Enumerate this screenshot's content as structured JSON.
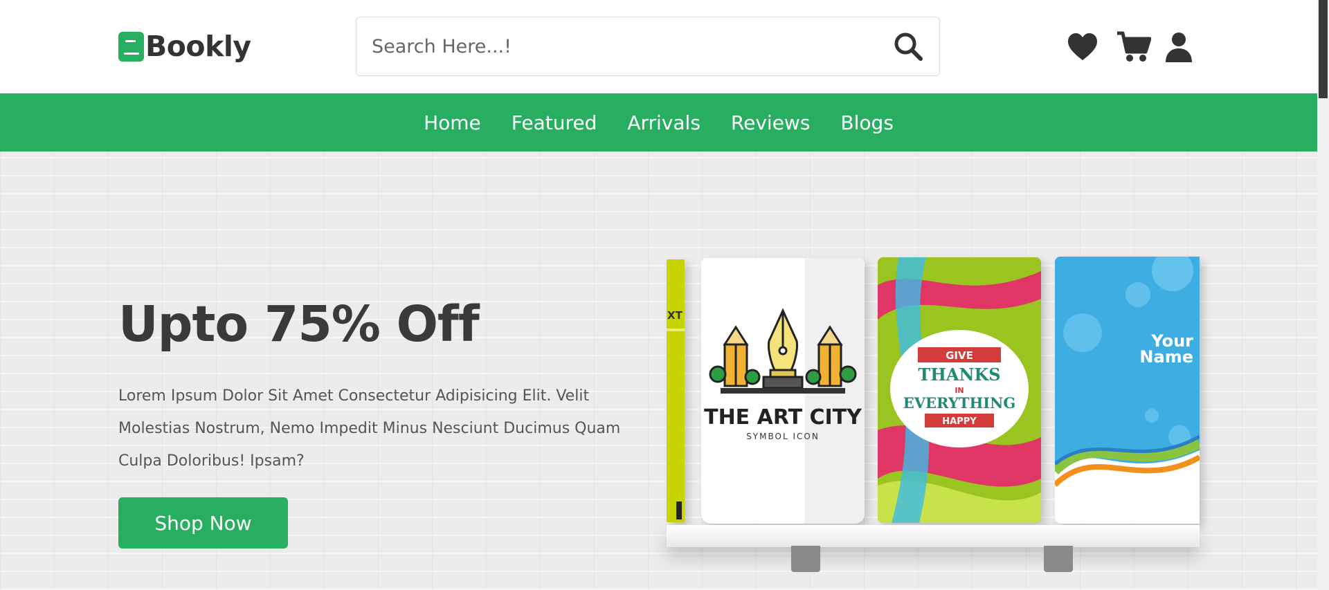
{
  "logo": {
    "text": "Bookly",
    "icon": "book-icon"
  },
  "search": {
    "placeholder": "Search Here...!",
    "value": "",
    "icon": "search-icon"
  },
  "header_icons": [
    {
      "name": "heart-icon",
      "label": "Wishlist"
    },
    {
      "name": "cart-icon",
      "label": "Cart"
    },
    {
      "name": "user-icon",
      "label": "Account"
    }
  ],
  "nav": {
    "items": [
      {
        "label": "Home"
      },
      {
        "label": "Featured"
      },
      {
        "label": "Arrivals"
      },
      {
        "label": "Reviews"
      },
      {
        "label": "Blogs"
      }
    ]
  },
  "hero": {
    "title": "Upto 75% Off",
    "description": "Lorem Ipsum Dolor Sit Amet Consectetur Adipisicing Elit. Velit Molestias Nostrum, Nemo Impedit Minus Nesciunt Ducimus Quam Culpa Doloribus! Ipsam?",
    "cta_label": "Shop Now"
  },
  "books": {
    "edge_text": "XT",
    "art_city": {
      "title": "THE ART CITY",
      "subtitle": "SYMBOL ICON"
    },
    "thanks": {
      "line1": "GIVE",
      "line2": "THANKS",
      "line3": "IN",
      "line4": "EVERYTHING",
      "line5": "HAPPY"
    },
    "your_name": {
      "line1": "Your",
      "line2": "Name"
    }
  },
  "colors": {
    "accent": "#27ae60",
    "text_dark": "#333333",
    "hero_bg": "#ececec"
  }
}
